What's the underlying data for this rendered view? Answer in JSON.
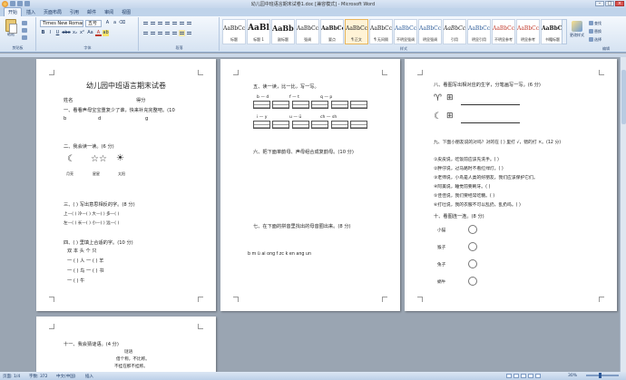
{
  "window": {
    "title": "幼儿园中班语言期末试卷1.doc [兼容模式] - Microsoft Word"
  },
  "tabs": [
    "开始",
    "插入",
    "页面布局",
    "引用",
    "邮件",
    "审阅",
    "视图"
  ],
  "ribbon": {
    "paste_label": "粘贴",
    "font_name": "Times New Roman",
    "font_size": "五号",
    "groups": {
      "clipboard": "剪贴板",
      "font": "字体",
      "paragraph": "段落",
      "styles": "样式",
      "editing": "编辑"
    },
    "format_buttons": [
      "B",
      "I",
      "U",
      "abe",
      "x₂",
      "x²",
      "Aa",
      "A"
    ],
    "styles": [
      {
        "sample": "AaBbCcDc",
        "name": "标题"
      },
      {
        "sample": "AaBl",
        "name": "标题 1"
      },
      {
        "sample": "AaBbC",
        "name": "副标题"
      },
      {
        "sample": "AaBbCcDc",
        "name": "强调"
      },
      {
        "sample": "AaBbCcD",
        "name": "要点"
      },
      {
        "sample": "AaBbCcDc",
        "name": "¶ 正文"
      },
      {
        "sample": "AaBbCcDc",
        "name": "¶ 无间隔"
      },
      {
        "sample": "AaBbCcDc",
        "name": "不明显强调"
      },
      {
        "sample": "AaBbCcDc",
        "name": "明显强调"
      },
      {
        "sample": "AaBbCcDc",
        "name": "引用"
      },
      {
        "sample": "AaBbCcDc",
        "name": "明显引用"
      },
      {
        "sample": "AaBbCcDc",
        "name": "不明显参考"
      },
      {
        "sample": "AaBbCcDc",
        "name": "明显参考"
      },
      {
        "sample": "AaBbCcDc",
        "name": "书籍标题"
      }
    ],
    "change_styles": "更改样式",
    "editing": [
      "查找",
      "替换",
      "选择"
    ]
  },
  "page1": {
    "title": "幼儿园中班语言期末试卷",
    "name_label": "姓名",
    "score_label": "得分",
    "q1": "一、看看声母宝宝重复少了谁，快来补充完整吧。(10",
    "q1_letters": [
      "b",
      "d",
      "g"
    ],
    "q2": "二、我会读一读。(6 分)",
    "q2_captions": [
      "月亮",
      "星星",
      "太阳"
    ],
    "q3": "三、( ) 写出意思相反的字。(8 分)",
    "q3_rows": [
      "上—(    )      冷—(    )      大—(    )      多—(    )",
      "左—(    )      长—(    )      小—(    )      远—(    )"
    ],
    "q4": "四、( ) 里填上合适的字。(10 分)",
    "q4_words": "双    本    头    个    只",
    "q4_rows": [
      "一 (    ) 人      一 (    ) 羊",
      "一 (    ) 鸟      一 (    ) 书",
      "一 (    ) 牛"
    ]
  },
  "page2": {
    "q5": "五、读一读，比一比，写一写。",
    "q5_pairs": [
      "b — d",
      "f — t",
      "q — p",
      "i — y",
      "u — ü",
      "ch — sh"
    ],
    "q6": "六、把下面单韵母、声母组合成复韵母。(10 分)",
    "q7": "七、在下面的拼音里找出的母音圈出来。(8 分)",
    "q7_letters": "b    m    ü    ai    ong    f    zc    k    en    ang    un"
  },
  "page3": {
    "q8": "八、看图写出相对应的生字，分笔画写一写。(6 分)",
    "q9": "九、下面小朋友说的对吗？对的在 (  ) 里打 √，错的打 ×。(12 分)",
    "q9_items": [
      "①皮皮说，吃饭前应该先洗手。(  )",
      "②胖仔说，过马路时不看红绿灯。(  )",
      "③老师说，小鸟是人类的好朋友，我们应该保护它们。",
      "④阿美说，睡觉前要刷牙。(  )",
      "⑤佳佳说，我们要经常吃糖。(  )",
      "⑥打吐说，我的衣服不可以乱扔，乱扔吗。(  )"
    ],
    "q10": "十、看图连一连。(8 分)",
    "q10_labels": [
      "小猫",
      "猴子",
      "兔子",
      "蜗牛"
    ]
  },
  "page4": {
    "q11": "十一、我会猜谜语。(4 分)",
    "riddle_title": "谜语",
    "riddle_lines": [
      "借个称，不比称。",
      "不挂在那不挂称。"
    ]
  },
  "status": {
    "page": "页面: 1/4",
    "words": "字数: 372",
    "lang": "中文(中国)",
    "mode": "插入",
    "zoom": "30%"
  }
}
